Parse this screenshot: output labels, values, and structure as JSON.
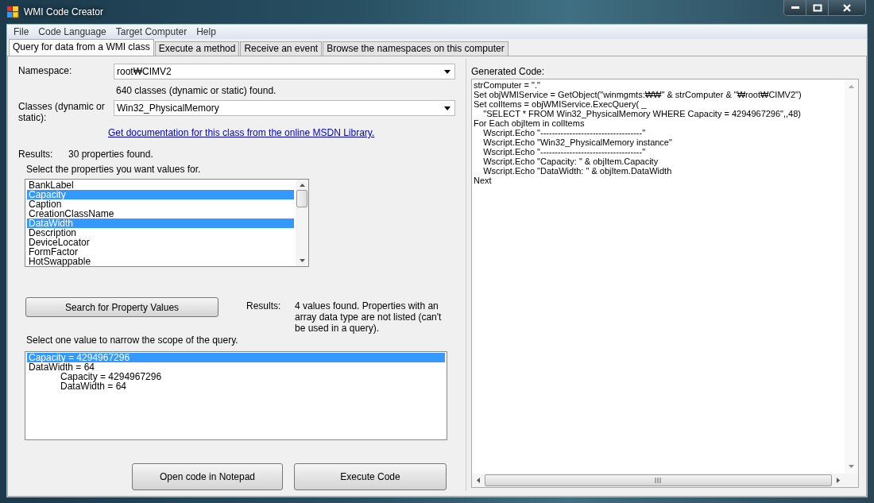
{
  "window": {
    "title": "WMI Code Creator"
  },
  "menu": [
    "File",
    "Code Language",
    "Target Computer",
    "Help"
  ],
  "tabs": [
    {
      "label": "Query for data from a WMI class",
      "selected": true
    },
    {
      "label": "Execute a method",
      "selected": false
    },
    {
      "label": "Receive an event",
      "selected": false
    },
    {
      "label": "Browse the namespaces on this computer",
      "selected": false
    }
  ],
  "query": {
    "namespace": {
      "label": "Namespace:",
      "value": "root₩CIMV2"
    },
    "classes_found": "640 classes (dynamic or static) found.",
    "classes": {
      "label": "Classes (dynamic or static):",
      "value": "Win32_PhysicalMemory"
    },
    "doc_link": "Get documentation for this class from the online MSDN Library.",
    "results_label": "Results:",
    "results_text": "30 properties found.",
    "properties_prompt": "Select the properties you want values for.",
    "properties": [
      {
        "label": "BankLabel",
        "selected": false
      },
      {
        "label": "Capacity",
        "selected": true
      },
      {
        "label": "Caption",
        "selected": false
      },
      {
        "label": "CreationClassName",
        "selected": false
      },
      {
        "label": "DataWidth",
        "selected": true
      },
      {
        "label": "Description",
        "selected": false
      },
      {
        "label": "DeviceLocator",
        "selected": false
      },
      {
        "label": "FormFactor",
        "selected": false
      },
      {
        "label": "HotSwappable",
        "selected": false
      }
    ],
    "search_button": "Search for Property Values",
    "values_results_label": "Results:",
    "values_results_text": "4 values found. Properties with an array data type are not listed (can't be used in a query).",
    "values_prompt": "Select one value to narrow the scope of the query.",
    "values": [
      {
        "text": "Capacity = 4294967296",
        "kind": "plain",
        "selected": true
      },
      {
        "text": "DataWidth = 64",
        "kind": "plain",
        "selected": false
      },
      {
        "text": "Capacity = 4294967296",
        "kind": "tabbed",
        "selected": false
      },
      {
        "text": "DataWidth = 64",
        "kind": "tabbed",
        "selected": false
      }
    ],
    "buttons": [
      "Open code in Notepad",
      "Execute Code"
    ]
  },
  "generated": {
    "label": "Generated Code:",
    "lines": [
      "strComputer = \".\"",
      "Set objWMIService = GetObject(\"winmgmts:₩₩\" & strComputer & \"₩root₩CIMV2\")",
      "Set colItems = objWMIService.ExecQuery( _",
      "    \"SELECT * FROM Win32_PhysicalMemory WHERE Capacity = 4294967296\",,48)",
      "For Each objItem in colItems",
      "    Wscript.Echo \"-----------------------------------\"",
      "    Wscript.Echo \"Win32_PhysicalMemory instance\"",
      "    Wscript.Echo \"-----------------------------------\"",
      "    Wscript.Echo \"Capacity: \" & objItem.Capacity",
      "    Wscript.Echo \"DataWidth: \" & objItem.DataWidth",
      "Next"
    ]
  }
}
